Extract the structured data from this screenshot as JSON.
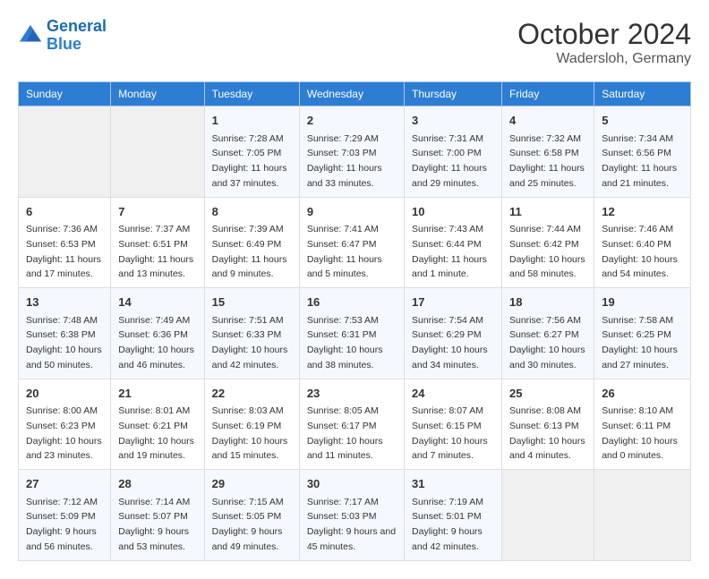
{
  "header": {
    "logo_line1": "General",
    "logo_line2": "Blue",
    "month_title": "October 2024",
    "location": "Wadersloh, Germany"
  },
  "weekdays": [
    "Sunday",
    "Monday",
    "Tuesday",
    "Wednesday",
    "Thursday",
    "Friday",
    "Saturday"
  ],
  "weeks": [
    [
      {
        "day": "",
        "detail": ""
      },
      {
        "day": "",
        "detail": ""
      },
      {
        "day": "1",
        "detail": "Sunrise: 7:28 AM\nSunset: 7:05 PM\nDaylight: 11 hours and 37 minutes."
      },
      {
        "day": "2",
        "detail": "Sunrise: 7:29 AM\nSunset: 7:03 PM\nDaylight: 11 hours and 33 minutes."
      },
      {
        "day": "3",
        "detail": "Sunrise: 7:31 AM\nSunset: 7:00 PM\nDaylight: 11 hours and 29 minutes."
      },
      {
        "day": "4",
        "detail": "Sunrise: 7:32 AM\nSunset: 6:58 PM\nDaylight: 11 hours and 25 minutes."
      },
      {
        "day": "5",
        "detail": "Sunrise: 7:34 AM\nSunset: 6:56 PM\nDaylight: 11 hours and 21 minutes."
      }
    ],
    [
      {
        "day": "6",
        "detail": "Sunrise: 7:36 AM\nSunset: 6:53 PM\nDaylight: 11 hours and 17 minutes."
      },
      {
        "day": "7",
        "detail": "Sunrise: 7:37 AM\nSunset: 6:51 PM\nDaylight: 11 hours and 13 minutes."
      },
      {
        "day": "8",
        "detail": "Sunrise: 7:39 AM\nSunset: 6:49 PM\nDaylight: 11 hours and 9 minutes."
      },
      {
        "day": "9",
        "detail": "Sunrise: 7:41 AM\nSunset: 6:47 PM\nDaylight: 11 hours and 5 minutes."
      },
      {
        "day": "10",
        "detail": "Sunrise: 7:43 AM\nSunset: 6:44 PM\nDaylight: 11 hours and 1 minute."
      },
      {
        "day": "11",
        "detail": "Sunrise: 7:44 AM\nSunset: 6:42 PM\nDaylight: 10 hours and 58 minutes."
      },
      {
        "day": "12",
        "detail": "Sunrise: 7:46 AM\nSunset: 6:40 PM\nDaylight: 10 hours and 54 minutes."
      }
    ],
    [
      {
        "day": "13",
        "detail": "Sunrise: 7:48 AM\nSunset: 6:38 PM\nDaylight: 10 hours and 50 minutes."
      },
      {
        "day": "14",
        "detail": "Sunrise: 7:49 AM\nSunset: 6:36 PM\nDaylight: 10 hours and 46 minutes."
      },
      {
        "day": "15",
        "detail": "Sunrise: 7:51 AM\nSunset: 6:33 PM\nDaylight: 10 hours and 42 minutes."
      },
      {
        "day": "16",
        "detail": "Sunrise: 7:53 AM\nSunset: 6:31 PM\nDaylight: 10 hours and 38 minutes."
      },
      {
        "day": "17",
        "detail": "Sunrise: 7:54 AM\nSunset: 6:29 PM\nDaylight: 10 hours and 34 minutes."
      },
      {
        "day": "18",
        "detail": "Sunrise: 7:56 AM\nSunset: 6:27 PM\nDaylight: 10 hours and 30 minutes."
      },
      {
        "day": "19",
        "detail": "Sunrise: 7:58 AM\nSunset: 6:25 PM\nDaylight: 10 hours and 27 minutes."
      }
    ],
    [
      {
        "day": "20",
        "detail": "Sunrise: 8:00 AM\nSunset: 6:23 PM\nDaylight: 10 hours and 23 minutes."
      },
      {
        "day": "21",
        "detail": "Sunrise: 8:01 AM\nSunset: 6:21 PM\nDaylight: 10 hours and 19 minutes."
      },
      {
        "day": "22",
        "detail": "Sunrise: 8:03 AM\nSunset: 6:19 PM\nDaylight: 10 hours and 15 minutes."
      },
      {
        "day": "23",
        "detail": "Sunrise: 8:05 AM\nSunset: 6:17 PM\nDaylight: 10 hours and 11 minutes."
      },
      {
        "day": "24",
        "detail": "Sunrise: 8:07 AM\nSunset: 6:15 PM\nDaylight: 10 hours and 7 minutes."
      },
      {
        "day": "25",
        "detail": "Sunrise: 8:08 AM\nSunset: 6:13 PM\nDaylight: 10 hours and 4 minutes."
      },
      {
        "day": "26",
        "detail": "Sunrise: 8:10 AM\nSunset: 6:11 PM\nDaylight: 10 hours and 0 minutes."
      }
    ],
    [
      {
        "day": "27",
        "detail": "Sunrise: 7:12 AM\nSunset: 5:09 PM\nDaylight: 9 hours and 56 minutes."
      },
      {
        "day": "28",
        "detail": "Sunrise: 7:14 AM\nSunset: 5:07 PM\nDaylight: 9 hours and 53 minutes."
      },
      {
        "day": "29",
        "detail": "Sunrise: 7:15 AM\nSunset: 5:05 PM\nDaylight: 9 hours and 49 minutes."
      },
      {
        "day": "30",
        "detail": "Sunrise: 7:17 AM\nSunset: 5:03 PM\nDaylight: 9 hours and 45 minutes."
      },
      {
        "day": "31",
        "detail": "Sunrise: 7:19 AM\nSunset: 5:01 PM\nDaylight: 9 hours and 42 minutes."
      },
      {
        "day": "",
        "detail": ""
      },
      {
        "day": "",
        "detail": ""
      }
    ]
  ]
}
